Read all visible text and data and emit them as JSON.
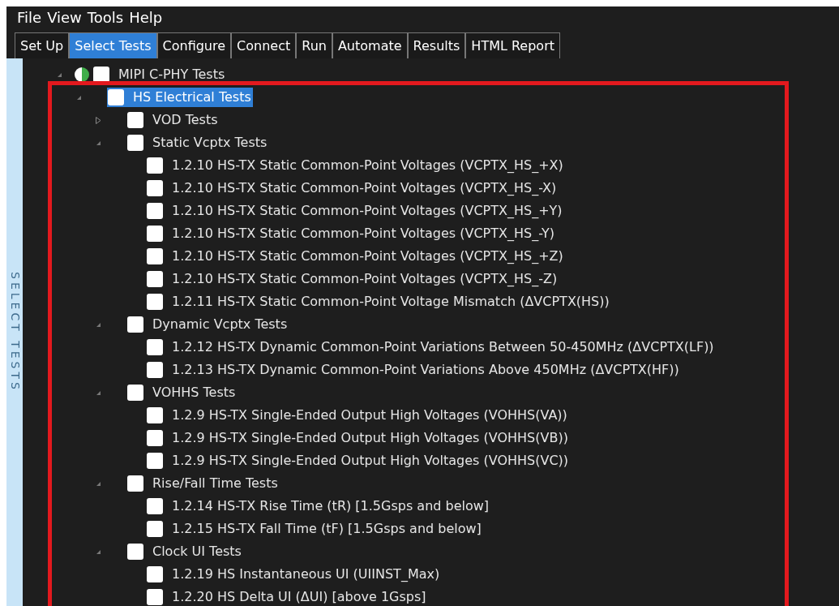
{
  "menu": [
    "File",
    "View",
    "Tools",
    "Help"
  ],
  "tabs": [
    {
      "label": "Set Up",
      "selected": false
    },
    {
      "label": "Select Tests",
      "selected": true
    },
    {
      "label": "Configure",
      "selected": false
    },
    {
      "label": "Connect",
      "selected": false
    },
    {
      "label": "Run",
      "selected": false
    },
    {
      "label": "Automate",
      "selected": false
    },
    {
      "label": "Results",
      "selected": false
    },
    {
      "label": "HTML Report",
      "selected": false
    }
  ],
  "side_label": "SELECT TESTS",
  "tree": [
    {
      "label": "MIPI C-PHY Tests",
      "checked": false,
      "selected": false,
      "expanded": true,
      "children": [
        {
          "label": "HS Electrical Tests",
          "checked": false,
          "selected": true,
          "expanded": true,
          "children": [
            {
              "label": "VOD Tests",
              "checked": false,
              "selected": false,
              "expanded": false
            },
            {
              "label": "Static Vcptx Tests",
              "checked": false,
              "selected": false,
              "expanded": true,
              "children": [
                {
                  "label": "1.2.10 HS-TX Static Common-Point Voltages (VCPTX_HS_+X)",
                  "checked": false,
                  "selected": false
                },
                {
                  "label": "1.2.10 HS-TX Static Common-Point Voltages (VCPTX_HS_-X)",
                  "checked": false,
                  "selected": false
                },
                {
                  "label": "1.2.10 HS-TX Static Common-Point Voltages (VCPTX_HS_+Y)",
                  "checked": false,
                  "selected": false
                },
                {
                  "label": "1.2.10 HS-TX Static Common-Point Voltages (VCPTX_HS_-Y)",
                  "checked": false,
                  "selected": false
                },
                {
                  "label": "1.2.10 HS-TX Static Common-Point Voltages (VCPTX_HS_+Z)",
                  "checked": false,
                  "selected": false
                },
                {
                  "label": "1.2.10 HS-TX Static Common-Point Voltages (VCPTX_HS_-Z)",
                  "checked": false,
                  "selected": false
                },
                {
                  "label": "1.2.11 HS-TX Static Common-Point Voltage Mismatch (ΔVCPTX(HS))",
                  "checked": false,
                  "selected": false
                }
              ]
            },
            {
              "label": "Dynamic Vcptx Tests",
              "checked": false,
              "selected": false,
              "expanded": true,
              "children": [
                {
                  "label": "1.2.12 HS-TX Dynamic Common-Point Variations Between 50-450MHz (ΔVCPTX(LF))",
                  "checked": false,
                  "selected": false
                },
                {
                  "label": "1.2.13 HS-TX Dynamic Common-Point Variations Above 450MHz (ΔVCPTX(HF))",
                  "checked": false,
                  "selected": false
                }
              ]
            },
            {
              "label": "VOHHS Tests",
              "checked": false,
              "selected": false,
              "expanded": true,
              "children": [
                {
                  "label": "1.2.9 HS-TX Single-Ended Output High Voltages (VOHHS(VA))",
                  "checked": false,
                  "selected": false
                },
                {
                  "label": "1.2.9 HS-TX Single-Ended Output High Voltages (VOHHS(VB))",
                  "checked": false,
                  "selected": false
                },
                {
                  "label": "1.2.9 HS-TX Single-Ended Output High Voltages (VOHHS(VC))",
                  "checked": false,
                  "selected": false
                }
              ]
            },
            {
              "label": "Rise/Fall Time Tests",
              "checked": false,
              "selected": false,
              "expanded": true,
              "children": [
                {
                  "label": "1.2.14 HS-TX Rise Time (tR) [1.5Gsps and below]",
                  "checked": false,
                  "selected": false
                },
                {
                  "label": "1.2.15 HS-TX Fall Time (tF) [1.5Gsps and below]",
                  "checked": false,
                  "selected": false
                }
              ]
            },
            {
              "label": "Clock UI Tests",
              "checked": false,
              "selected": false,
              "expanded": true,
              "children": [
                {
                  "label": "1.2.19 HS Instantaneous UI (UIINST_Max)",
                  "checked": false,
                  "selected": false
                },
                {
                  "label": "1.2.20 HS Delta UI (ΔUI) [above 1Gsps]",
                  "checked": false,
                  "selected": false
                }
              ]
            }
          ]
        }
      ]
    }
  ]
}
